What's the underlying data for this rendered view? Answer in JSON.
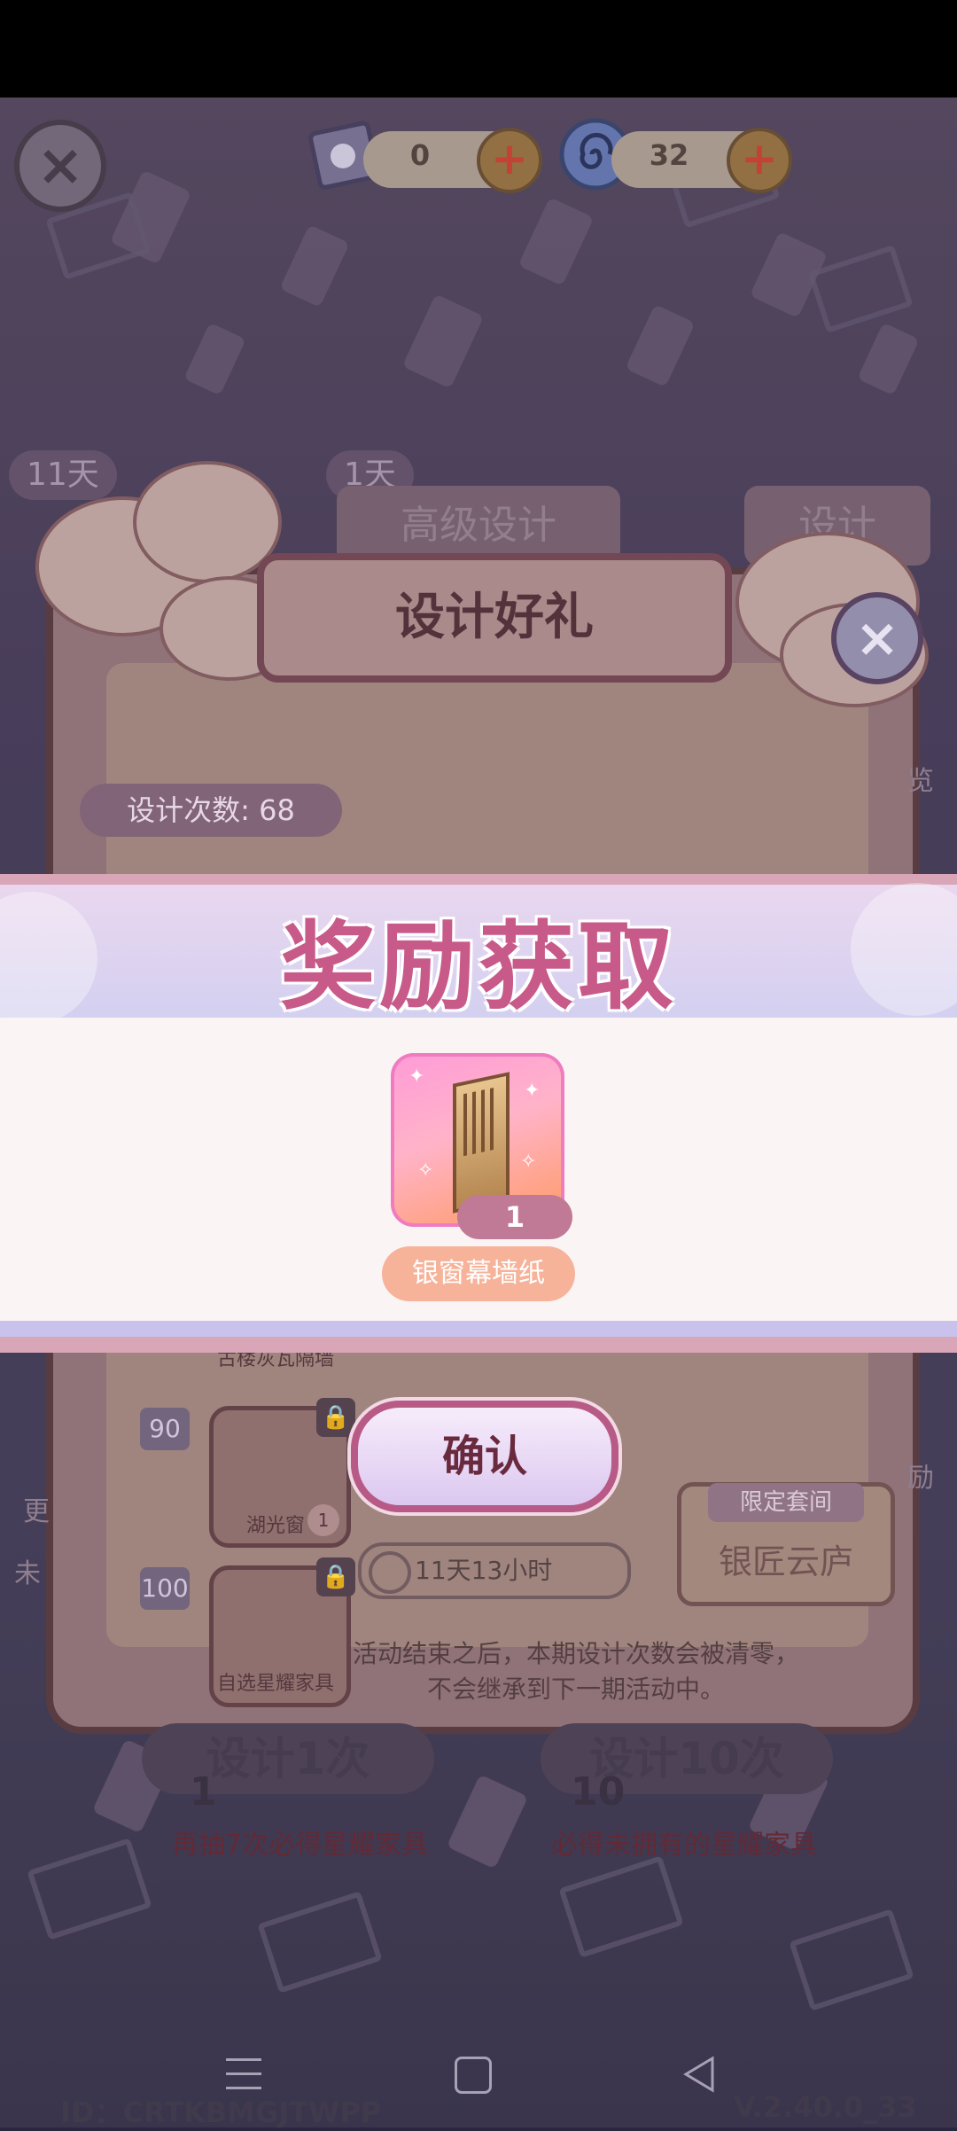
{
  "header": {
    "close_icon": "close-icon",
    "resources": [
      {
        "name": "design-ticket",
        "icon": "ticket-icon",
        "value": "0"
      },
      {
        "name": "spiral-gem",
        "icon": "spiral-gem-icon",
        "value": "32"
      }
    ]
  },
  "panel": {
    "title": "设计好礼",
    "design_count": "设计次数: 68",
    "day_tags": [
      "11天",
      "1天"
    ],
    "tabs": [
      "高级设计",
      "设计"
    ],
    "milestones": [
      {
        "step": "90",
        "item": "湖光窗",
        "qty": "1",
        "locked": true
      },
      {
        "step": "100",
        "item": "自选星耀家具",
        "locked": true
      }
    ],
    "prev_item_label": "古楼灰瓦隔墙",
    "timer": "11天13小时",
    "suite": {
      "tag": "限定套间",
      "name": "银匠云庐"
    },
    "notice_lines": [
      "活动结束之后，本期设计次数会被清零，",
      "不会继承到下一期活动中。"
    ],
    "side_labels": [
      "更",
      "未",
      "览",
      "励"
    ]
  },
  "design_buttons": [
    {
      "label": "设计1次",
      "count": "1",
      "hint": "再抽7次必得星耀家具"
    },
    {
      "label": "设计10次",
      "count": "10",
      "hint": "必得未拥有的星耀家具"
    }
  ],
  "reward": {
    "title": "奖励获取",
    "item": {
      "name": "银窗幕墙纸",
      "quantity": "1",
      "icon": "wallpaper-icon"
    },
    "confirm_label": "确认"
  },
  "footer": {
    "id": "ID：CRTKBMGJTWPP",
    "version": "V.2.40.0_33"
  },
  "colors": {
    "banner_title": "#c85a8a",
    "confirm_border": "#b85a86",
    "reward_name_bg": "#f6b39a"
  }
}
